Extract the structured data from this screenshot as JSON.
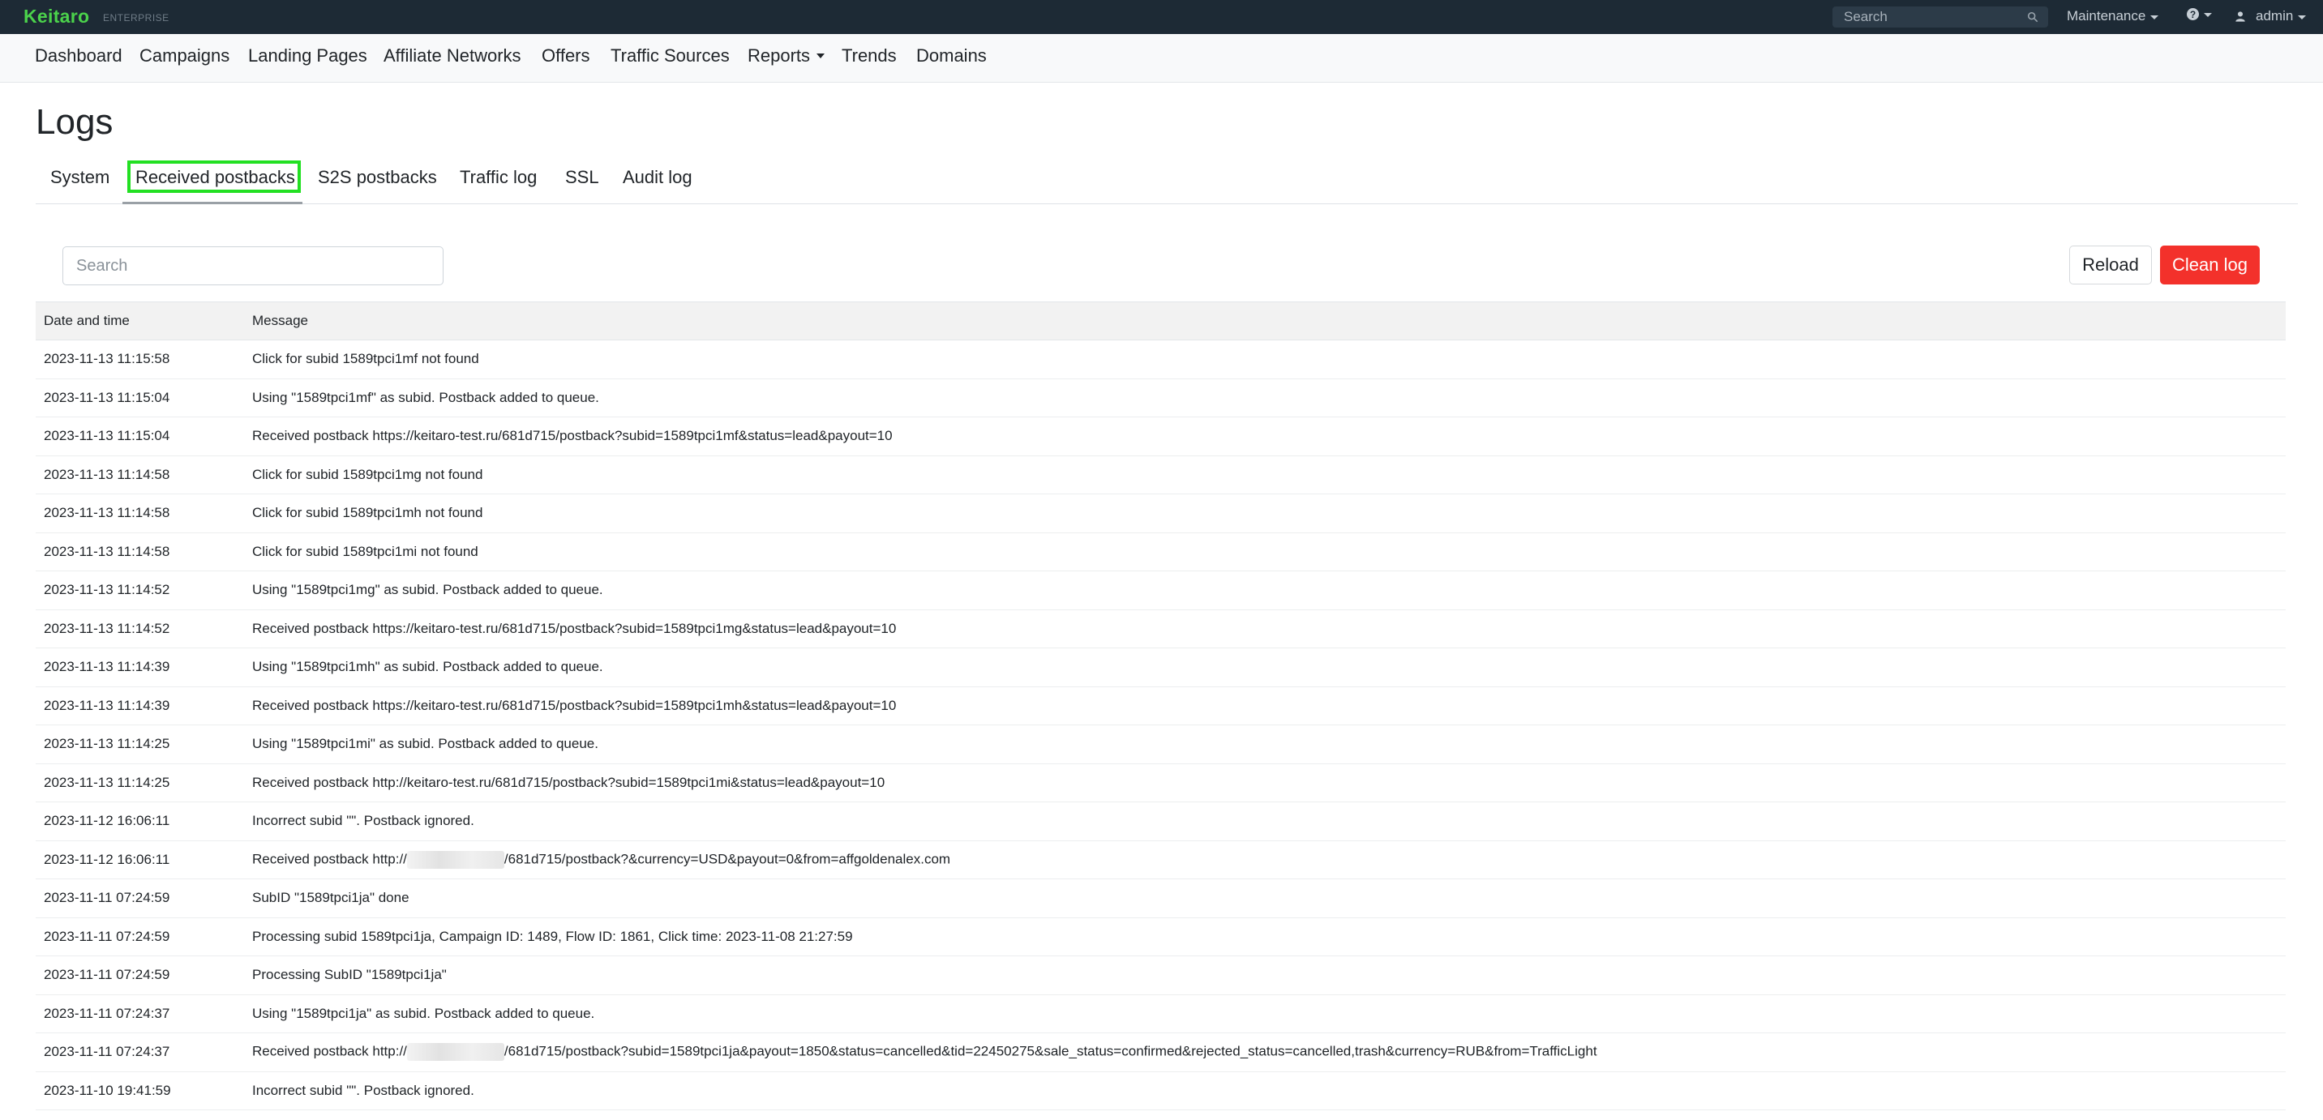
{
  "topbar": {
    "brand": "Keitaro",
    "edition": "ENTERPRISE",
    "search_placeholder": "Search",
    "maintenance_label": "Maintenance",
    "help_symbol": "?",
    "user_label": "admin"
  },
  "nav": {
    "items": [
      "Dashboard",
      "Campaigns",
      "Landing Pages",
      "Affiliate Networks",
      "Offers",
      "Traffic Sources",
      "Reports",
      "Trends",
      "Domains"
    ]
  },
  "page": {
    "title": "Logs"
  },
  "tabs": {
    "items": [
      "System",
      "Received postbacks",
      "S2S postbacks",
      "Traffic log",
      "SSL",
      "Audit log"
    ],
    "active": "Received postbacks"
  },
  "toolbar": {
    "search_placeholder": "Search",
    "reload_label": "Reload",
    "clean_label": "Clean log"
  },
  "table": {
    "headers": [
      "Date and time",
      "Message"
    ],
    "rows": [
      {
        "date": "2023-11-13 11:15:58",
        "message": "Click for subid 1589tpci1mf not found"
      },
      {
        "date": "2023-11-13 11:15:04",
        "message": "Using \"1589tpci1mf\" as subid. Postback added to queue."
      },
      {
        "date": "2023-11-13 11:15:04",
        "message": "Received postback https://keitaro-test.ru/681d715/postback?subid=1589tpci1mf&status=lead&payout=10"
      },
      {
        "date": "2023-11-13 11:14:58",
        "message": "Click for subid 1589tpci1mg not found"
      },
      {
        "date": "2023-11-13 11:14:58",
        "message": "Click for subid 1589tpci1mh not found"
      },
      {
        "date": "2023-11-13 11:14:58",
        "message": "Click for subid 1589tpci1mi not found"
      },
      {
        "date": "2023-11-13 11:14:52",
        "message": "Using \"1589tpci1mg\" as subid. Postback added to queue."
      },
      {
        "date": "2023-11-13 11:14:52",
        "message": "Received postback https://keitaro-test.ru/681d715/postback?subid=1589tpci1mg&status=lead&payout=10"
      },
      {
        "date": "2023-11-13 11:14:39",
        "message": "Using \"1589tpci1mh\" as subid. Postback added to queue."
      },
      {
        "date": "2023-11-13 11:14:39",
        "message": "Received postback https://keitaro-test.ru/681d715/postback?subid=1589tpci1mh&status=lead&payout=10"
      },
      {
        "date": "2023-11-13 11:14:25",
        "message": "Using \"1589tpci1mi\" as subid. Postback added to queue."
      },
      {
        "date": "2023-11-13 11:14:25",
        "message": "Received postback http://keitaro-test.ru/681d715/postback?subid=1589tpci1mi&status=lead&payout=10"
      },
      {
        "date": "2023-11-12 16:06:11",
        "message": "Incorrect subid \"\". Postback ignored."
      },
      {
        "date": "2023-11-12 16:06:11",
        "message": "Received postback http://",
        "redacted": true,
        "message_after": "/681d715/postback?&currency=USD&payout=0&from=affgoldenalex.com"
      },
      {
        "date": "2023-11-11 07:24:59",
        "message": "SubID \"1589tpci1ja\" done"
      },
      {
        "date": "2023-11-11 07:24:59",
        "message": "Processing subid 1589tpci1ja, Campaign ID: 1489, Flow ID: 1861, Click time: 2023-11-08 21:27:59"
      },
      {
        "date": "2023-11-11 07:24:59",
        "message": "Processing SubID \"1589tpci1ja\""
      },
      {
        "date": "2023-11-11 07:24:37",
        "message": "Using \"1589tpci1ja\" as subid. Postback added to queue."
      },
      {
        "date": "2023-11-11 07:24:37",
        "message": "Received postback http://",
        "redacted": true,
        "message_after": "/681d715/postback?subid=1589tpci1ja&payout=1850&status=cancelled&tid=22450275&sale_status=confirmed&rejected_status=cancelled,trash&currency=RUB&from=TrafficLight"
      },
      {
        "date": "2023-11-10 19:41:59",
        "message": "Incorrect subid \"\". Postback ignored."
      }
    ]
  },
  "colors": {
    "topbar_bg": "#1d2a35",
    "brand_green": "#4bd24b",
    "danger_red": "#f3312b",
    "active_tab_highlight": "#22e022"
  },
  "icons": {
    "search": "search-icon",
    "user": "user-icon",
    "help": "help-icon",
    "dropdown": "chevron-down-icon"
  }
}
